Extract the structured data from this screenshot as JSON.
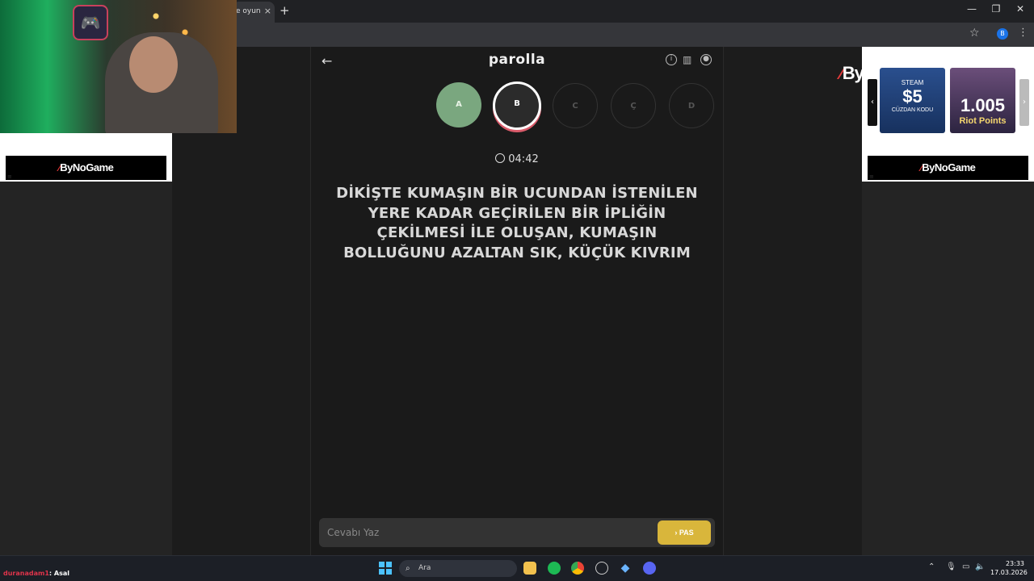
{
  "browser": {
    "tab_title": "e oyun",
    "tab_close": "×",
    "new_tab": "+",
    "minimize": "—",
    "restore": "❐",
    "close": "✕",
    "profile_initial": "B"
  },
  "ads": {
    "brand": "ByNoGame",
    "steam_label": "STEAM",
    "steam_value": "$5",
    "steam_sub": "CÜZDAN KODU",
    "riot_value": "1.005",
    "riot_sub": "Riot Points"
  },
  "game": {
    "title": "parolla",
    "letters": [
      {
        "label": "A",
        "state": "done"
      },
      {
        "label": "B",
        "state": "current"
      },
      {
        "label": "C",
        "state": "idle"
      },
      {
        "label": "Ç",
        "state": "idle"
      },
      {
        "label": "D",
        "state": "idle"
      }
    ],
    "timer": "04:42",
    "question": "DİKİŞTE KUMAŞIN BİR UCUNDAN İSTENİLEN YERE KADAR GEÇİRİLEN BİR İPLİĞİN ÇEKİLMESİ İLE OLUŞAN, KUMAŞIN BOLLUĞUNU AZALTAN SIK, KÜÇÜK KIVRIM",
    "answer_placeholder": "Cevabı Yaz",
    "pass_label": "PAS"
  },
  "chat": {
    "user": "duranadam1",
    "message": ": Asal"
  },
  "taskbar": {
    "search_placeholder": "Ara",
    "time": "23:33",
    "date": "17.03.2026"
  },
  "colors": {
    "done": "#7aa77f",
    "current_ring": "#d95b6a",
    "pass_button": "#d9b63b"
  }
}
